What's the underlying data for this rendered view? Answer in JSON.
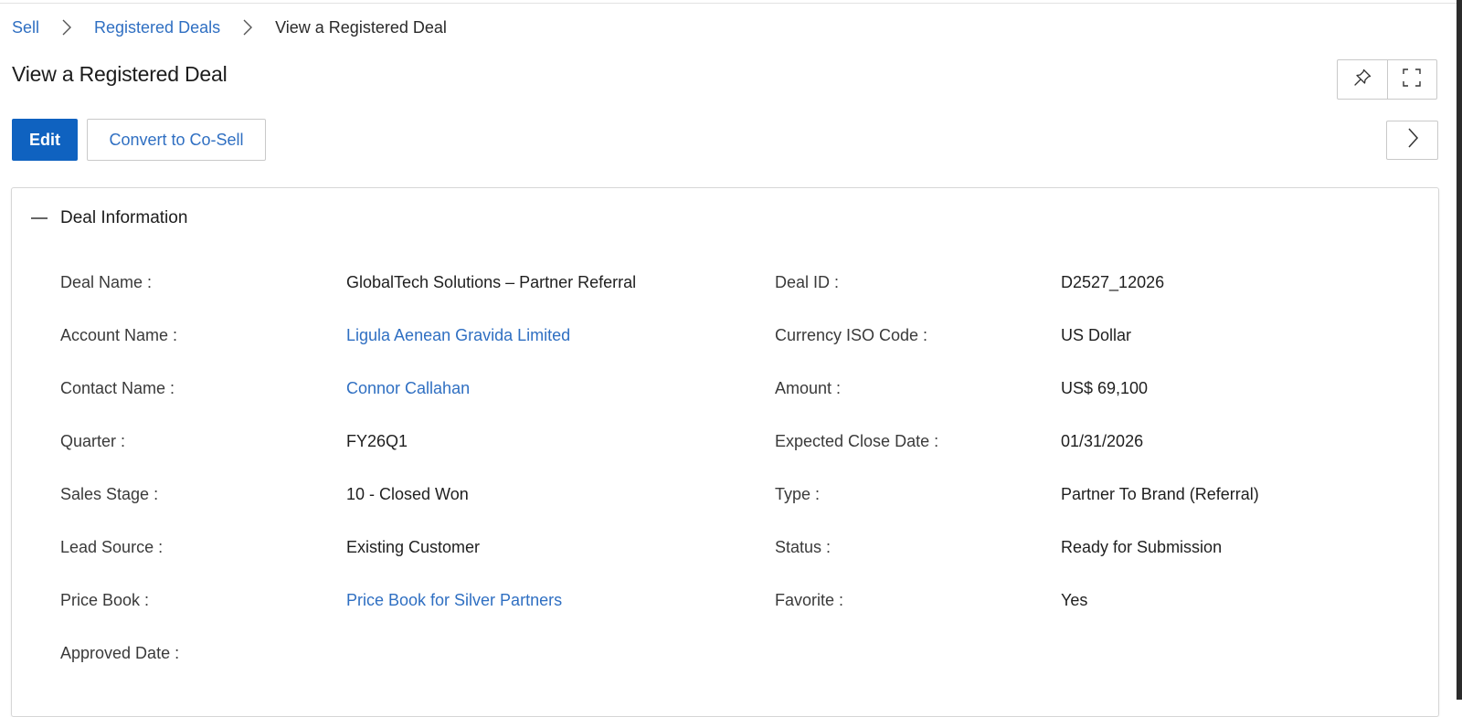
{
  "breadcrumb": {
    "items": [
      "Sell",
      "Registered Deals",
      "View a Registered Deal"
    ]
  },
  "page": {
    "title": "View a Registered Deal"
  },
  "toolbar": {
    "edit_label": "Edit",
    "convert_label": "Convert to Co-Sell"
  },
  "icons": {
    "pin": "pin-icon",
    "fullscreen": "fullscreen-icon",
    "next": "chevron-right-icon",
    "collapse": "minus-icon"
  },
  "colors": {
    "primary": "#0f62c0",
    "link": "#2f6fc2"
  },
  "section": {
    "title": "Deal Information"
  },
  "fields": {
    "left": [
      {
        "label": "Deal Name :",
        "value": "GlobalTech Solutions – Partner Referral",
        "link": false
      },
      {
        "label": "Account Name :",
        "value": "Ligula Aenean Gravida Limited",
        "link": true
      },
      {
        "label": "Contact Name :",
        "value": "Connor Callahan",
        "link": true
      },
      {
        "label": "Quarter :",
        "value": "FY26Q1",
        "link": false
      },
      {
        "label": "Sales Stage :",
        "value": "10 - Closed Won",
        "link": false
      },
      {
        "label": "Lead Source :",
        "value": "Existing Customer",
        "link": false
      },
      {
        "label": "Price Book :",
        "value": "Price Book for Silver Partners",
        "link": true
      },
      {
        "label": "Approved Date :",
        "value": "",
        "link": false
      }
    ],
    "right": [
      {
        "label": "Deal ID :",
        "value": "D2527_12026",
        "link": false
      },
      {
        "label": "Currency ISO Code :",
        "value": "US Dollar",
        "link": false
      },
      {
        "label": "Amount :",
        "value": "US$ 69,100",
        "link": false
      },
      {
        "label": "Expected Close Date :",
        "value": "01/31/2026",
        "link": false
      },
      {
        "label": "Type :",
        "value": "Partner To Brand (Referral)",
        "link": false
      },
      {
        "label": "Status :",
        "value": "Ready for Submission",
        "link": false
      },
      {
        "label": "Favorite :",
        "value": "Yes",
        "link": false
      }
    ]
  }
}
